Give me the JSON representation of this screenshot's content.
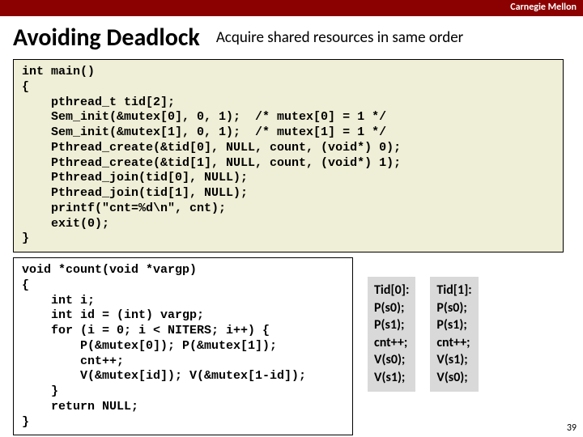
{
  "header": {
    "label": "Carnegie Mellon"
  },
  "title": "Avoiding Deadlock",
  "subtitle": "Acquire shared resources in same order",
  "code_main": "int main()\n{\n    pthread_t tid[2];\n    Sem_init(&mutex[0], 0, 1);  /* mutex[0] = 1 */\n    Sem_init(&mutex[1], 0, 1);  /* mutex[1] = 1 */\n    Pthread_create(&tid[0], NULL, count, (void*) 0);\n    Pthread_create(&tid[1], NULL, count, (void*) 1);\n    Pthread_join(tid[0], NULL);\n    Pthread_join(tid[1], NULL);\n    printf(\"cnt=%d\\n\", cnt);\n    exit(0);\n}",
  "code_count": "void *count(void *vargp)\n{\n    int i;\n    int id = (int) vargp;\n    for (i = 0; i < NITERS; i++) {\n        P(&mutex[0]); P(&mutex[1]);\n        cnt++;\n        V(&mutex[id]); V(&mutex[1-id]);\n    }\n    return NULL;\n}",
  "tid0": "Tid[0]:\nP(s0);\nP(s1);\ncnt++;\nV(s0);\nV(s1);",
  "tid1": "Tid[1]:\nP(s0);\nP(s1);\ncnt++;\nV(s1);\nV(s0);",
  "page_number": "39"
}
